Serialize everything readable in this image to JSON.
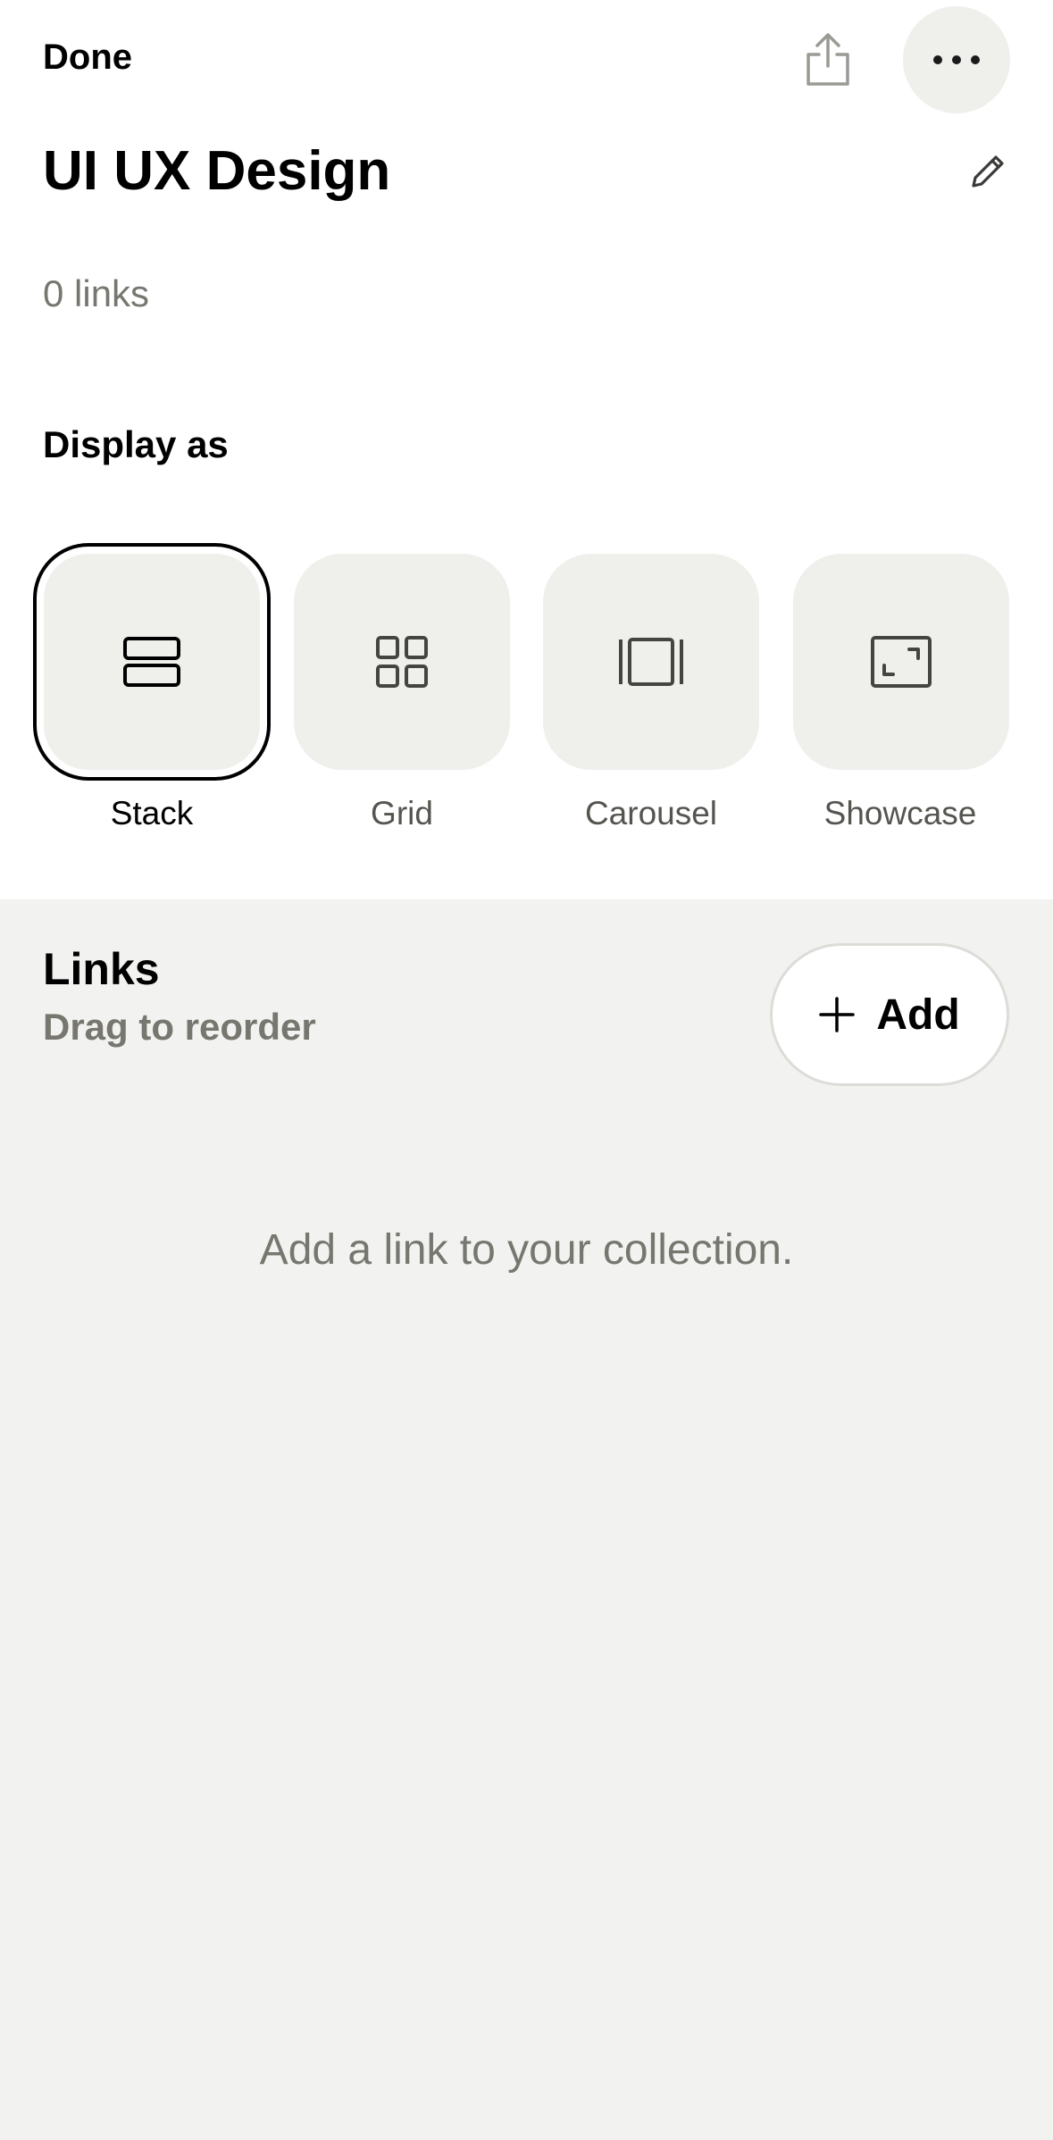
{
  "header": {
    "done_label": "Done",
    "share_icon": "share-icon",
    "more_icon": "more-horizontal-icon"
  },
  "collection": {
    "title": "UI UX Design",
    "edit_icon": "pencil-icon",
    "link_count": "0 links"
  },
  "display": {
    "label": "Display as",
    "selected": "Stack",
    "options": [
      {
        "label": "Stack",
        "icon": "stack-icon"
      },
      {
        "label": "Grid",
        "icon": "grid-icon"
      },
      {
        "label": "Carousel",
        "icon": "carousel-icon"
      },
      {
        "label": "Showcase",
        "icon": "showcase-icon"
      }
    ]
  },
  "links": {
    "heading": "Links",
    "subtitle": "Drag to reorder",
    "add_label": "Add",
    "add_icon": "plus-icon",
    "empty_message": "Add a link to your collection."
  },
  "colors": {
    "background": "#f2f2f0",
    "surface": "#ffffff",
    "tile": "#efefec",
    "muted_text": "#777770",
    "text": "#000000"
  }
}
